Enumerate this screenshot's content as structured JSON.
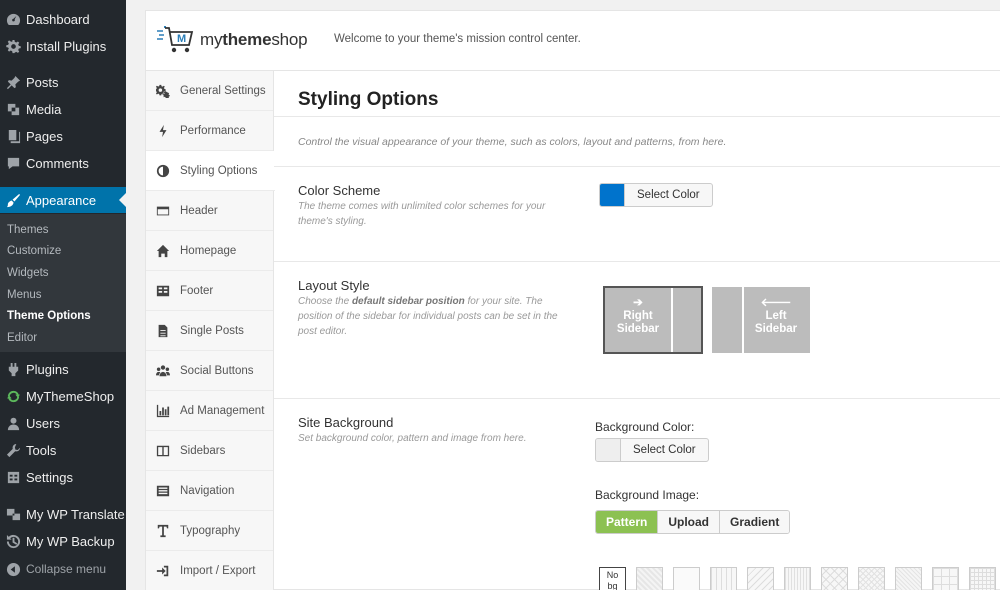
{
  "wp_menu": {
    "items": [
      {
        "label": "Dashboard",
        "icon": "dashboard-icon"
      },
      {
        "label": "Install Plugins",
        "icon": "gear-icon"
      },
      {
        "label": "Posts",
        "icon": "pin-icon"
      },
      {
        "label": "Media",
        "icon": "media-icon"
      },
      {
        "label": "Pages",
        "icon": "pages-icon"
      },
      {
        "label": "Comments",
        "icon": "comment-icon"
      },
      {
        "label": "Appearance",
        "icon": "brush-icon"
      },
      {
        "label": "Plugins",
        "icon": "plugin-icon"
      },
      {
        "label": "MyThemeShop",
        "icon": "refresh-icon"
      },
      {
        "label": "Users",
        "icon": "user-icon"
      },
      {
        "label": "Tools",
        "icon": "wrench-icon"
      },
      {
        "label": "Settings",
        "icon": "settings-icon"
      },
      {
        "label": "My WP Translate",
        "icon": "translate-icon"
      },
      {
        "label": "My WP Backup",
        "icon": "backup-icon"
      },
      {
        "label": "Collapse menu",
        "icon": "collapse-icon"
      }
    ],
    "appearance_sub": [
      "Themes",
      "Customize",
      "Widgets",
      "Menus",
      "Theme Options",
      "Editor"
    ],
    "current_sub": "Theme Options",
    "accent_color": "#0073aa"
  },
  "header": {
    "logo_prefix": "my",
    "logo_bold": "theme",
    "logo_suffix": "shop",
    "logo_badge": "M",
    "welcome": "Welcome to your theme's mission control center."
  },
  "tabs": [
    {
      "label": "General Settings",
      "icon": "gears-icon"
    },
    {
      "label": "Performance",
      "icon": "bolt-icon"
    },
    {
      "label": "Styling Options",
      "icon": "adjust-icon"
    },
    {
      "label": "Header",
      "icon": "header-icon"
    },
    {
      "label": "Homepage",
      "icon": "home-icon"
    },
    {
      "label": "Footer",
      "icon": "table-icon"
    },
    {
      "label": "Single Posts",
      "icon": "file-icon"
    },
    {
      "label": "Social Buttons",
      "icon": "users-icon"
    },
    {
      "label": "Ad Management",
      "icon": "bar-chart-icon"
    },
    {
      "label": "Sidebars",
      "icon": "columns-icon"
    },
    {
      "label": "Navigation",
      "icon": "list-icon"
    },
    {
      "label": "Typography",
      "icon": "text-icon"
    },
    {
      "label": "Import / Export",
      "icon": "sign-in-icon"
    }
  ],
  "content": {
    "title": "Styling Options",
    "intro": "Control the visual appearance of your theme, such as colors, layout and patterns, from here.",
    "color_scheme": {
      "title": "Color Scheme",
      "desc": "The theme comes with unlimited color schemes for your theme's styling.",
      "button": "Select Color",
      "swatch": "#0073cc"
    },
    "layout_style": {
      "title": "Layout Style",
      "desc_pre": "Choose the ",
      "desc_bold": "default sidebar position",
      "desc_post": " for your site. The position of the sidebar for individual posts can be set in the post editor.",
      "right": {
        "arrow": "➔",
        "line1": "Right",
        "line2": "Sidebar"
      },
      "left": {
        "arrow": "🡐",
        "line1": "Left",
        "line2": "Sidebar"
      }
    },
    "site_background": {
      "title": "Site Background",
      "desc": "Set background color, pattern and image from here.",
      "bg_color_label": "Background Color:",
      "bg_color_button": "Select Color",
      "bg_image_label": "Background Image:",
      "image_options": [
        "Pattern",
        "Upload",
        "Gradient"
      ],
      "active_option": "Pattern",
      "no_bg_line1": "No",
      "no_bg_line2": "bg"
    }
  }
}
